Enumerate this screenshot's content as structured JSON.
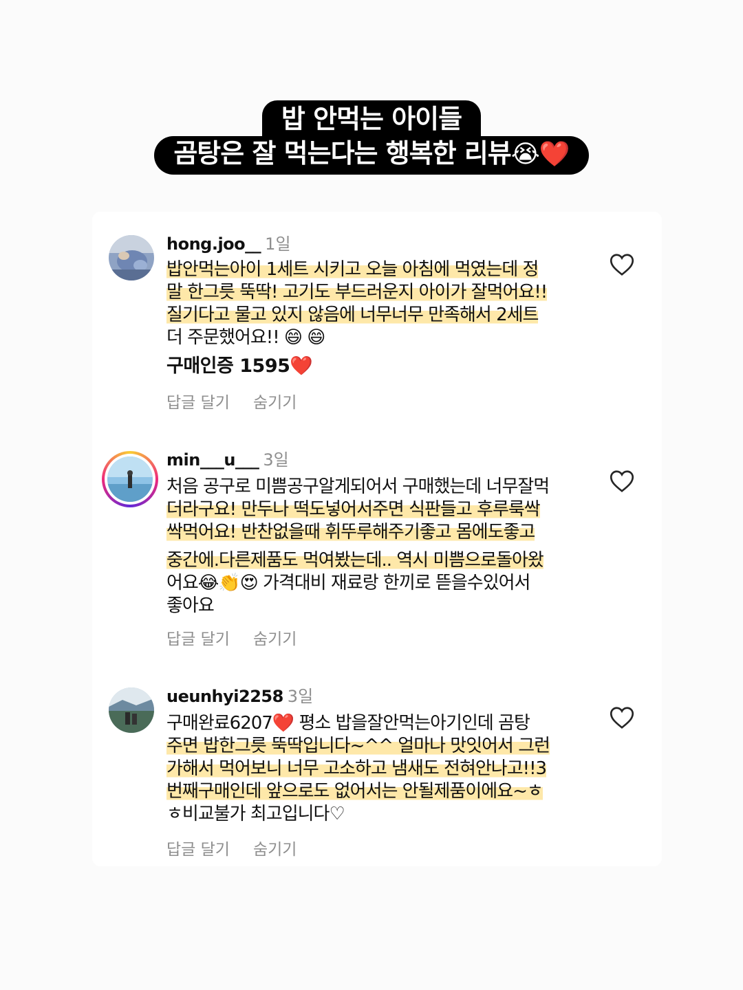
{
  "title": {
    "line1": "밥 안먹는 아이들",
    "line2": "곰탕은 잘 먹는다는 행복한 리뷰",
    "emoji_cry": "😭",
    "emoji_heart": "❤️"
  },
  "comments": [
    {
      "username": "hong.joo__",
      "age": "1일",
      "lines": [
        "밥안먹는아이 1세트 시키고 오늘 아침에 먹였는데 정",
        "말 한그릇 뚝딱! 고기도 부드러운지 아이가 잘먹어요!!",
        "질기다고 물고 있지 않음에 너무너무 만족해서 2세트",
        "더 주문했어요!! 😄 😄"
      ],
      "cert": "구매인증 1595❤️",
      "reply": "답글 달기",
      "hide": "숨기기"
    },
    {
      "username": "min___u___",
      "age": "3일",
      "lines": [
        "처음 공구로 미쁨공구알게되어서 구매했는데 너무잘먹",
        "더라구요! 만두나 떡도넣어서주면 식판들고 후루룩싹",
        "싹먹어요! 반찬없을때 휘뚜루해주기좋고 몸에도좋고",
        "중간에.다른제품도 먹여봤는데.. 역시 미쁨으로돌아왔",
        "어요😂👏😍 가격대비 재료랑 한끼로 뜯을수있어서",
        "좋아요"
      ],
      "reply": "답글 달기",
      "hide": "숨기기"
    },
    {
      "username": "ueunhyi2258",
      "age": "3일",
      "lines": [
        "구매완료6207❤️ 평소 밥을잘안먹는아기인데 곰탕",
        "주면 밥한그릇 뚝딱입니다~^^ 얼마나 맛잇어서 그런",
        "가해서 먹어보니 너무 고소하고 냄새도 전혀안나고!!3",
        "번째구매인데 앞으로도 없어서는 안될제품이에요~ㅎ",
        "ㅎ비교불가 최고입니다♡"
      ],
      "reply": "답글 달기",
      "hide": "숨기기"
    }
  ]
}
